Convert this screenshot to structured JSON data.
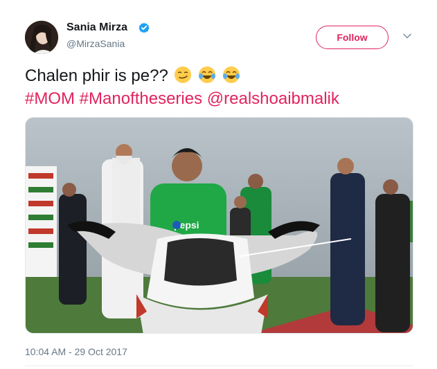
{
  "user": {
    "name": "Sania Mirza",
    "handle": "@MirzaSania",
    "verified_icon": "verified-badge-icon"
  },
  "follow_button": {
    "label": "Follow"
  },
  "menu_icon": "chevron-down-icon",
  "tweet": {
    "text": "Chalen phir is pe??",
    "emojis": [
      "smirk-face-emoji",
      "tears-of-joy-emoji",
      "tears-of-joy-emoji"
    ],
    "hashtags": [
      "#MOM",
      "#Manoftheseries"
    ],
    "mention": "@realshoaibmalik"
  },
  "media": {
    "jersey_text": "pepsi"
  },
  "timestamp": "10:04 AM - 29 Oct 2017",
  "colors": {
    "accent": "#e0245e",
    "verified": "#1da1f2",
    "secondary_text": "#657786"
  }
}
